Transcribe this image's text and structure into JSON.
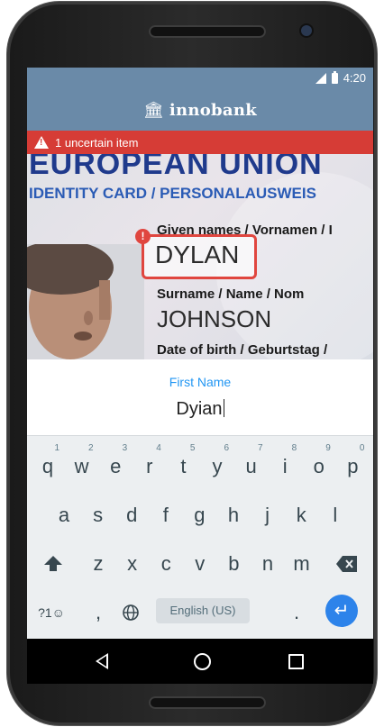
{
  "status_bar": {
    "time": "4:20"
  },
  "app_bar": {
    "title": "innobank",
    "icon": "bank-icon"
  },
  "alert": {
    "text": "1 uncertain item",
    "icon": "warning-icon"
  },
  "id_card": {
    "header": "EUROPEAN UNION",
    "subheader": "IDENTITY CARD / PERSONALAUSWEIS",
    "given_label": "Given names / Vornamen / I",
    "given_value": "DYLAN",
    "surname_label": "Surname / Name / Nom",
    "surname_value": "JOHNSON",
    "dob_label": "Date of birth / Geburtstag /",
    "uncertain_badge": "!"
  },
  "edit_field": {
    "label": "First Name",
    "value": "Dyian"
  },
  "keyboard": {
    "row1": [
      "q",
      "w",
      "e",
      "r",
      "t",
      "y",
      "u",
      "i",
      "o",
      "p"
    ],
    "row1_hints": [
      "1",
      "2",
      "3",
      "4",
      "5",
      "6",
      "7",
      "8",
      "9",
      "0"
    ],
    "row2": [
      "a",
      "s",
      "d",
      "f",
      "g",
      "h",
      "j",
      "k",
      "l"
    ],
    "row3": [
      "z",
      "x",
      "c",
      "v",
      "b",
      "n",
      "m"
    ],
    "symbols_key": "?1☺",
    "comma_key": ",",
    "space_label": "English (US)",
    "period_key": "."
  },
  "colors": {
    "accent": "#6a8aa8",
    "alert": "#d63c36",
    "input_label": "#2196f3",
    "enter_key": "#2d83ea"
  }
}
